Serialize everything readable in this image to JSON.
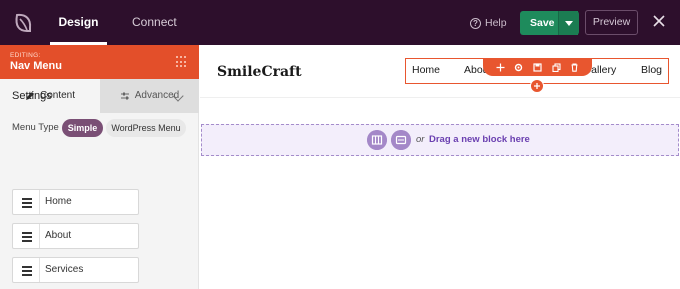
{
  "topbar": {
    "tabs": [
      {
        "label": "Design",
        "active": true
      },
      {
        "label": "Connect",
        "active": false
      }
    ],
    "help_label": "Help",
    "save_label": "Save",
    "preview_label": "Preview",
    "colors": {
      "background": "#2d0f2c",
      "save": "#1e8b5c"
    }
  },
  "sidebar": {
    "editing_label": "EDITING:",
    "editing_title": "Nav Menu",
    "subtabs": [
      {
        "label": "Content",
        "icon": "pencil-icon",
        "active": true
      },
      {
        "label": "Advanced",
        "icon": "sliders-icon",
        "active": false
      }
    ],
    "section_title": "Settings",
    "menu_type_label": "Menu Type",
    "menu_type_options": [
      {
        "label": "Simple",
        "selected": true
      },
      {
        "label": "WordPress Menu",
        "selected": false
      }
    ],
    "menu_items": [
      {
        "label": "Home"
      },
      {
        "label": "About"
      },
      {
        "label": "Services"
      }
    ],
    "accent_color": "#e34f2a"
  },
  "canvas": {
    "site_logo": "SmileCraft",
    "nav_links": [
      "Home",
      "About",
      "Gallery",
      "Blog"
    ],
    "toolbar_icons": [
      "move-icon",
      "settings-icon",
      "save-icon",
      "duplicate-icon",
      "delete-icon"
    ],
    "drop_zone": {
      "or_label": "or",
      "text": "Drag a new block here",
      "icons": [
        "columns-icon",
        "block-icon"
      ]
    }
  }
}
